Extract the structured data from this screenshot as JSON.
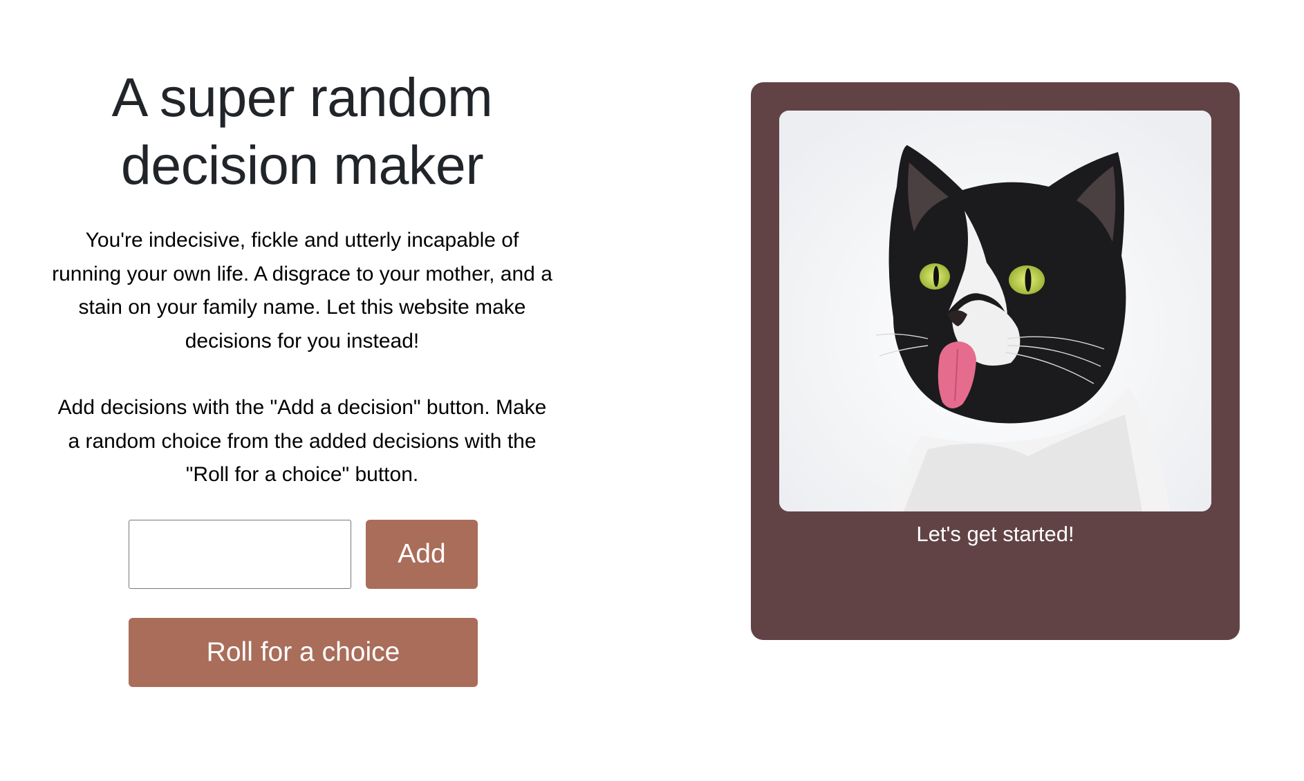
{
  "main": {
    "title": "A super random decision maker",
    "description_1": "You're indecisive, fickle and utterly incapable of running your own life. A disgrace to your mother, and a stain on your family name. Let this website make decisions for you instead!",
    "description_2": "Add decisions with the \"Add a decision\" button. Make a random choice from the added decisions with the \"Roll for a choice\" button.",
    "input": {
      "value": "",
      "placeholder": ""
    },
    "add_button_label": "Add",
    "roll_button_label": "Roll for a choice"
  },
  "result_card": {
    "image": "cat-sticking-tongue-out",
    "caption": "Let's get started!"
  },
  "colors": {
    "button": "#a96d5a",
    "card": "#614346",
    "title": "#212529"
  }
}
